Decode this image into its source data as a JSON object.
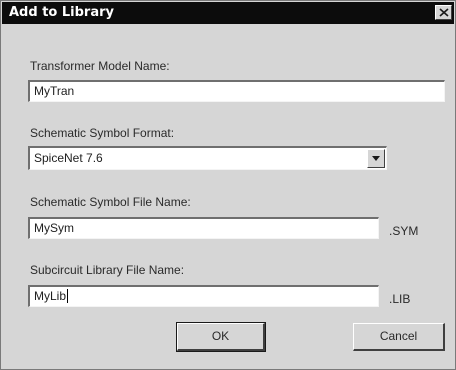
{
  "window": {
    "title": "Add to Library"
  },
  "icons": {
    "close": "close-x-icon",
    "dropdown": "chevron-down-icon"
  },
  "fields": {
    "model_name": {
      "label": "Transformer Model Name:",
      "value": "MyTran"
    },
    "symbol_format": {
      "label": "Schematic Symbol Format:",
      "value": "SpiceNet 7.6"
    },
    "symbol_file": {
      "label": "Schematic Symbol File Name:",
      "value": "MySym",
      "extension": ".SYM"
    },
    "library_file": {
      "label": "Subcircuit Library File Name:",
      "value": "MyLib",
      "extension": ".LIB"
    }
  },
  "buttons": {
    "ok": "OK",
    "cancel": "Cancel"
  },
  "colors": {
    "titlebar": "#0c0c0c",
    "dialog_face": "#d6d6d6",
    "field_background": "#ffffff"
  }
}
